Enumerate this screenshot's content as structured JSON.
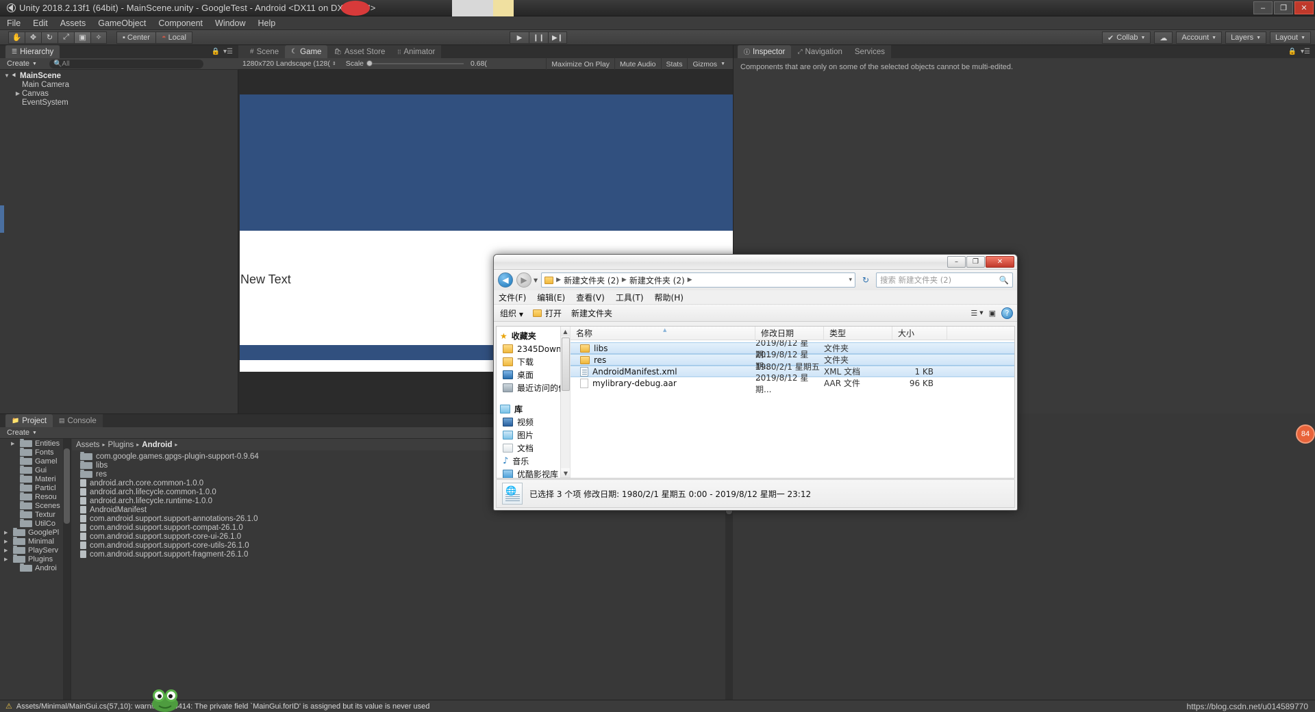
{
  "window": {
    "title": "Unity 2018.2.13f1 (64bit) - MainScene.unity - GoogleTest - Android <DX11 on DX9 GPU>",
    "minimize": "–",
    "maximize": "❐",
    "close": "✕"
  },
  "menubar": {
    "items": [
      "File",
      "Edit",
      "Assets",
      "GameObject",
      "Component",
      "Window",
      "Help"
    ]
  },
  "toolbar": {
    "tools": [
      "hand-tool",
      "move-tool",
      "rotate-tool",
      "scale-tool",
      "rect-tool",
      "transform-tool"
    ],
    "pivot": "Center",
    "space": "Local",
    "play": "▶",
    "pause": "❙❙",
    "step": "▶❙",
    "collab": "Collab",
    "cloud": "☁",
    "account": "Account",
    "layers": "Layers",
    "layout": "Layout"
  },
  "hierarchy": {
    "tab": "Hierarchy",
    "create": "Create",
    "search_placeholder": "All",
    "tree": [
      {
        "label": "MainScene",
        "depth": 0,
        "expanded": true,
        "is_scene": true
      },
      {
        "label": "Main Camera",
        "depth": 1,
        "expanded": null,
        "is_scene": false
      },
      {
        "label": "Canvas",
        "depth": 1,
        "expanded": false,
        "is_scene": false
      },
      {
        "label": "EventSystem",
        "depth": 1,
        "expanded": null,
        "is_scene": false
      }
    ]
  },
  "gameview": {
    "tabs": [
      {
        "label": "Scene",
        "active": false
      },
      {
        "label": "Game",
        "active": true
      },
      {
        "label": "Asset Store",
        "active": false
      },
      {
        "label": "Animator",
        "active": false
      }
    ],
    "resolution": "1280x720 Landscape (128(",
    "scale_label": "Scale",
    "scale_value": "0.68(",
    "maximize_on_play": "Maximize On Play",
    "mute_audio": "Mute Audio",
    "stats": "Stats",
    "gizmos": "Gizmos",
    "canvas_text": "New Text"
  },
  "inspector": {
    "tabs": [
      {
        "label": "Inspector",
        "active": true
      },
      {
        "label": "Navigation",
        "active": false
      },
      {
        "label": "Services",
        "active": false
      }
    ],
    "note": "Components that are only on some of the selected objects cannot be multi-edited."
  },
  "project": {
    "tabs": [
      {
        "label": "Project",
        "active": true
      },
      {
        "label": "Console",
        "active": false
      }
    ],
    "create": "Create",
    "breadcrumb": [
      "Assets",
      "Plugins",
      "Android"
    ],
    "tree": [
      "Entities",
      "Fonts",
      "Gamel",
      "Gui",
      "Materi",
      "Particl",
      "Resou",
      "Scenes",
      "Textur",
      "UtilCo",
      "GooglePl",
      "Minimal",
      "PlayServ",
      "Plugins",
      "Androi"
    ],
    "tree_meta": [
      {
        "label": "Entities",
        "depth": 1,
        "arrow": true
      },
      {
        "label": "Fonts",
        "depth": 1,
        "arrow": false
      },
      {
        "label": "Gamel",
        "depth": 1,
        "arrow": false
      },
      {
        "label": "Gui",
        "depth": 1,
        "arrow": false
      },
      {
        "label": "Materi",
        "depth": 1,
        "arrow": false
      },
      {
        "label": "Particl",
        "depth": 1,
        "arrow": false
      },
      {
        "label": "Resou",
        "depth": 1,
        "arrow": false
      },
      {
        "label": "Scenes",
        "depth": 1,
        "arrow": false
      },
      {
        "label": "Textur",
        "depth": 1,
        "arrow": false
      },
      {
        "label": "UtilCo",
        "depth": 1,
        "arrow": false
      },
      {
        "label": "GooglePl",
        "depth": 0,
        "arrow": true
      },
      {
        "label": "Minimal",
        "depth": 0,
        "arrow": true
      },
      {
        "label": "PlayServ",
        "depth": 0,
        "arrow": true
      },
      {
        "label": "Plugins",
        "depth": 0,
        "arrow": true
      },
      {
        "label": "Androi",
        "depth": 1,
        "arrow": false
      }
    ],
    "files": [
      {
        "label": "com.google.games.gpgs-plugin-support-0.9.64",
        "type": "folder"
      },
      {
        "label": "libs",
        "type": "folder"
      },
      {
        "label": "res",
        "type": "folder"
      },
      {
        "label": "android.arch.core.common-1.0.0",
        "type": "file"
      },
      {
        "label": "android.arch.lifecycle.common-1.0.0",
        "type": "file"
      },
      {
        "label": "android.arch.lifecycle.runtime-1.0.0",
        "type": "file"
      },
      {
        "label": "AndroidManifest",
        "type": "xml"
      },
      {
        "label": "com.android.support.support-annotations-26.1.0",
        "type": "file"
      },
      {
        "label": "com.android.support.support-compat-26.1.0",
        "type": "file"
      },
      {
        "label": "com.android.support.support-core-ui-26.1.0",
        "type": "file"
      },
      {
        "label": "com.android.support.support-core-utils-26.1.0",
        "type": "file"
      },
      {
        "label": "com.android.support.support-fragment-26.1.0",
        "type": "file"
      }
    ]
  },
  "statusbar": {
    "message": "Assets/Minimal/MainGui.cs(57,10): warning CS0414: The private field `MainGui.forID' is assigned but its value is never used",
    "watermark": "https://blog.csdn.net/u014589770"
  },
  "explorer": {
    "titlebar": {
      "minimize": "–",
      "maximize": "❐",
      "close": "✕"
    },
    "address": {
      "crumbs": [
        "新建文件夹 (2)",
        "新建文件夹 (2)"
      ],
      "dropdown": "▾",
      "refresh": "↻"
    },
    "search_placeholder": "搜索 新建文件夹 (2)",
    "menu": [
      "文件(F)",
      "编辑(E)",
      "查看(V)",
      "工具(T)",
      "帮助(H)"
    ],
    "commands": {
      "organize": "组织",
      "open": "打开",
      "new_folder": "新建文件夹",
      "view": "☰",
      "preview": "▣",
      "help": "?"
    },
    "sidebar": [
      {
        "label": "收藏夹",
        "icon": "star-icon",
        "head": true
      },
      {
        "label": "2345Downlo",
        "icon": "folder-icon",
        "head": false
      },
      {
        "label": "下载",
        "icon": "download-icon",
        "head": false
      },
      {
        "label": "桌面",
        "icon": "desktop-icon",
        "head": false
      },
      {
        "label": "最近访问的位",
        "icon": "recent-icon",
        "head": false
      },
      {
        "label": "库",
        "icon": "library-icon",
        "head": true
      },
      {
        "label": "视频",
        "icon": "video-icon",
        "head": false
      },
      {
        "label": "图片",
        "icon": "picture-icon",
        "head": false
      },
      {
        "label": "文档",
        "icon": "document-icon",
        "head": false
      },
      {
        "label": "音乐",
        "icon": "music-icon",
        "head": false
      },
      {
        "label": "优酷影视库",
        "icon": "youku-icon",
        "head": false
      }
    ],
    "columns": [
      "名称",
      "修改日期",
      "类型",
      "大小"
    ],
    "rows": [
      {
        "name": "libs",
        "date": "2019/8/12 星期...",
        "type": "文件夹",
        "size": "",
        "icon": "folder-icon",
        "selected": true
      },
      {
        "name": "res",
        "date": "2019/8/12 星期...",
        "type": "文件夹",
        "size": "",
        "icon": "folder-icon",
        "selected": true
      },
      {
        "name": "AndroidManifest.xml",
        "date": "1980/2/1 星期五 ...",
        "type": "XML 文档",
        "size": "1 KB",
        "icon": "xml-icon",
        "selected": true
      },
      {
        "name": "mylibrary-debug.aar",
        "date": "2019/8/12 星期...",
        "type": "AAR 文件",
        "size": "96 KB",
        "icon": "file-icon",
        "selected": false
      }
    ],
    "status": "已选择 3 个项  修改日期: 1980/2/1 星期五 0:00 - 2019/8/12 星期一 23:12"
  },
  "badge": {
    "count": "84"
  }
}
